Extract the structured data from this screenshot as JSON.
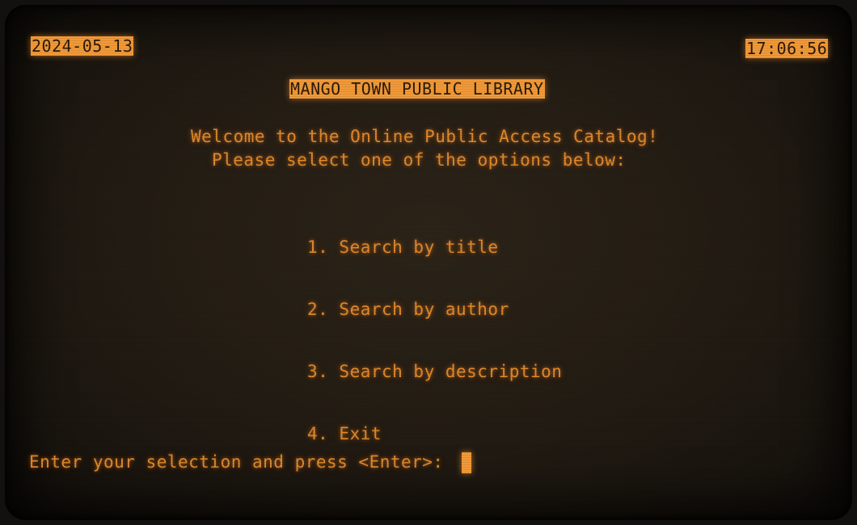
{
  "header": {
    "date": "2024-05-13",
    "time": "17:06:56",
    "title": "MANGO TOWN PUBLIC LIBRARY"
  },
  "intro": {
    "line1": "Welcome to the Online Public Access Catalog!",
    "line2": "Please select one of the options below:"
  },
  "menu": {
    "items": [
      {
        "label": "1. Search by title"
      },
      {
        "label": "2. Search by author"
      },
      {
        "label": "3. Search by description"
      },
      {
        "label": "4. Exit"
      }
    ]
  },
  "prompt": {
    "text": "Enter your selection and press <Enter>:",
    "input_value": ""
  },
  "colors": {
    "phosphor": "#e08a2c",
    "highlight": "#f29a38",
    "background": "#241d14"
  }
}
